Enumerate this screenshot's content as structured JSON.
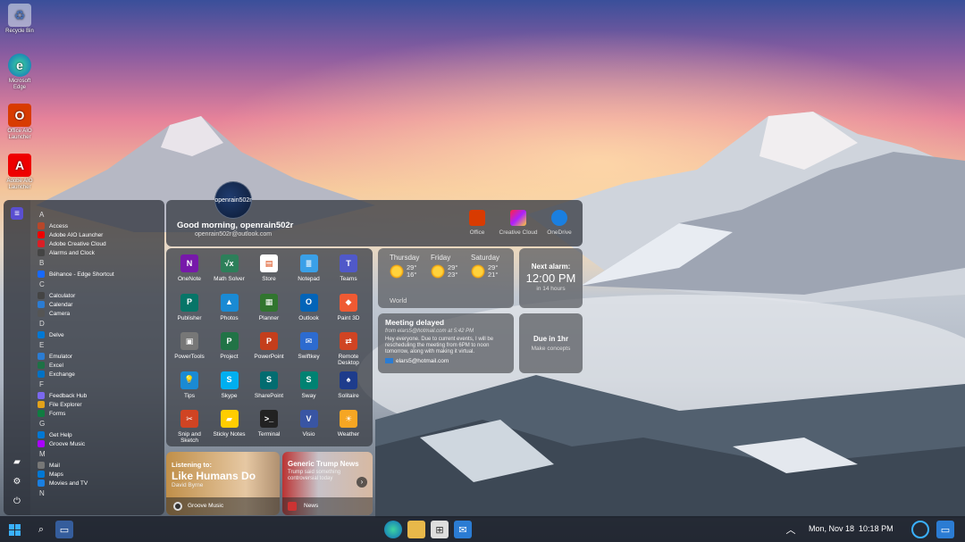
{
  "desktop": {
    "icons": [
      {
        "label": "Recycle Bin"
      },
      {
        "label": "Microsoft Edge"
      },
      {
        "label": "Office AIO Launcher"
      },
      {
        "label": "Adobe AIO Launcher"
      }
    ]
  },
  "start": {
    "groups": [
      {
        "letter": "A",
        "apps": [
          "Access",
          "Adobe AIO Launcher",
          "Adobe Creative Cloud",
          "Alarms and Clock"
        ]
      },
      {
        "letter": "B",
        "apps": [
          "Béhance - Edge Shortcut"
        ]
      },
      {
        "letter": "C",
        "apps": [
          "Calculator",
          "Calendar",
          "Camera"
        ]
      },
      {
        "letter": "D",
        "apps": [
          "Delve"
        ]
      },
      {
        "letter": "E",
        "apps": [
          "Emulator",
          "Excel",
          "Exchange"
        ]
      },
      {
        "letter": "F",
        "apps": [
          "Feedback Hub",
          "File Explorer",
          "Forms"
        ]
      },
      {
        "letter": "G",
        "apps": [
          "Get Help",
          "Groove Music"
        ]
      },
      {
        "letter": "M",
        "apps": [
          "Mail",
          "Maps",
          "Movies and TV"
        ]
      },
      {
        "letter": "N",
        "apps": []
      }
    ],
    "header": {
      "avatar_name": "openrain502r",
      "greeting": "Good morning, openrain502r",
      "email": "openrain502r@outlook.com",
      "apps": [
        "Office",
        "Creative Cloud",
        "OneDrive"
      ]
    },
    "pinned": [
      "OneNote",
      "Math Solver",
      "Store",
      "Notepad",
      "Teams",
      "Publisher",
      "Photos",
      "Planner",
      "Outlook",
      "Paint 3D",
      "PowerTools",
      "Project",
      "PowerPoint",
      "Swiftkey",
      "Remote Desktop",
      "Tips",
      "Skype",
      "SharePoint",
      "Sway",
      "Solitaire",
      "Snip and Sketch",
      "Sticky Notes",
      "Terminal",
      "Visio",
      "Weather"
    ],
    "weather": {
      "days": [
        {
          "day": "Thursday",
          "hi": "29°",
          "lo": "16°"
        },
        {
          "day": "Friday",
          "hi": "29°",
          "lo": "23°"
        },
        {
          "day": "Saturday",
          "hi": "29°",
          "lo": "21°"
        }
      ],
      "location": "World"
    },
    "alarm": {
      "title": "Next alarm:",
      "time": "12:00 PM",
      "sub": "in 14 hours"
    },
    "mail": {
      "subject": "Meeting delayed",
      "from": "from elars5@hotmail.com at 5:42 PM",
      "body": "Hey everyone. Due to current events, I will be rescheduling the meeting from 6PM to noon tomorrow, along with making it virtual.",
      "sender": "elars5@hotmail.com"
    },
    "due": {
      "title": "Due in 1hr",
      "sub": "Make concepts"
    },
    "music": {
      "label": "Listening to:",
      "title": "Like Humans Do",
      "artist": "David Byrne",
      "app": "Groove Music"
    },
    "news": {
      "title": "Generic Trump News",
      "snippet": "Trump said something controversial today",
      "app": "News"
    }
  },
  "taskbar": {
    "date": "Mon, Nov 18",
    "time": "10:18 PM"
  },
  "colors": {
    "accent": "#2b7cd3"
  }
}
